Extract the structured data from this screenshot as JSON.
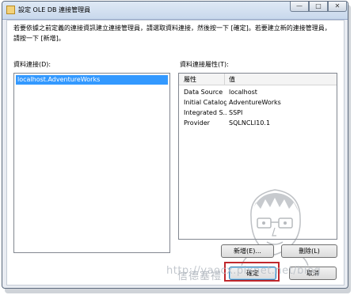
{
  "window": {
    "title": "設定 OLE DB 連接管理員",
    "min_symbol": "—",
    "max_symbol": "□",
    "close_symbol": "✕"
  },
  "description": "若要依據之前定義的連接資訊建立連接管理員，請選取資料連接，然後按一下 [確定]。若要建立新的連接管理員，請按一下 [新增]。",
  "labels": {
    "data_connections": "資料連接(D):",
    "connection_properties": "資料連接屬性(T):"
  },
  "connections": [
    "localhost.AdventureWorks"
  ],
  "properties": {
    "header_property": "屬性",
    "header_value": "值",
    "rows": [
      {
        "key": "Data Source",
        "value": "localhost"
      },
      {
        "key": "Initial Catalog",
        "value": "AdventureWorks"
      },
      {
        "key": "Integrated S...",
        "value": "SSPI"
      },
      {
        "key": "Provider",
        "value": "SQLNCLI10.1"
      }
    ]
  },
  "buttons": {
    "new": "新增(E)...",
    "delete": "刪除(L)",
    "ok": "確定",
    "cancel": "取消"
  },
  "watermark": {
    "line1": "信德塞禮",
    "line2": "http://yaocx.pixnet.net/blog"
  },
  "colors": {
    "selection": "#3399ff",
    "highlight_box": "#c0282d"
  }
}
